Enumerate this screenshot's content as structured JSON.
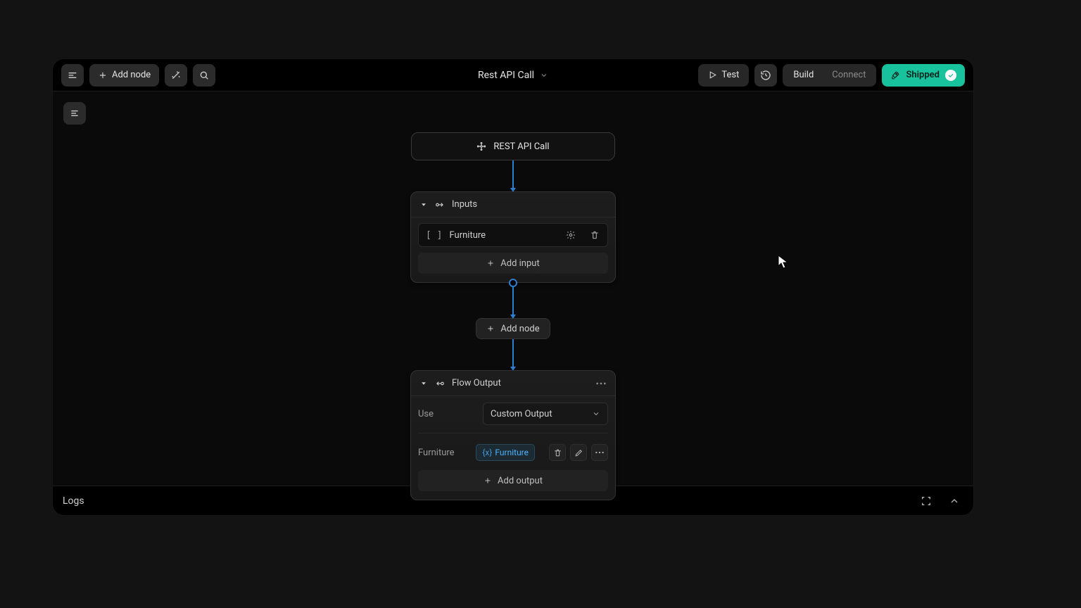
{
  "header": {
    "add_node": "Add node",
    "title": "Rest API Call",
    "test": "Test",
    "tabs": {
      "build": "Build",
      "connect": "Connect"
    },
    "shipped": "Shipped"
  },
  "trigger": {
    "label": "REST API Call"
  },
  "inputs_node": {
    "title": "Inputs",
    "items": [
      {
        "name": "Furniture"
      }
    ],
    "add_label": "Add input"
  },
  "inline_add": "Add node",
  "output_node": {
    "title": "Flow Output",
    "use_label": "Use",
    "use_value": "Custom Output",
    "rows": [
      {
        "label": "Furniture",
        "chip": "Furniture"
      }
    ],
    "add_label": "Add output"
  },
  "logs": {
    "label": "Logs"
  }
}
